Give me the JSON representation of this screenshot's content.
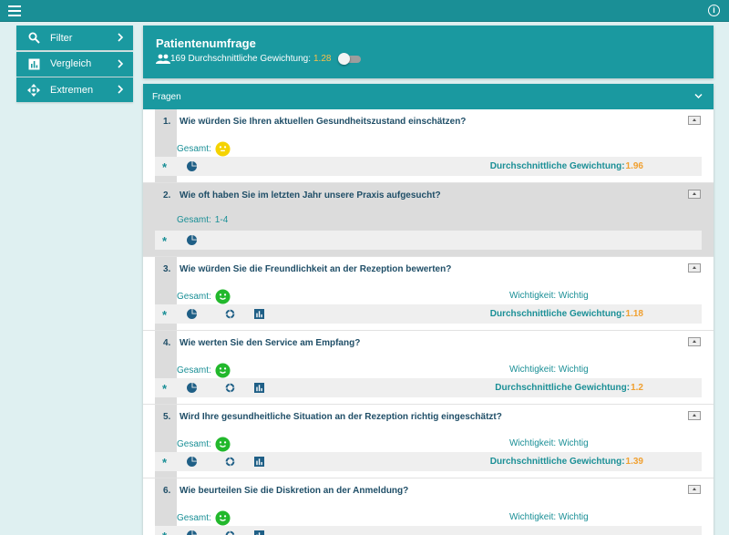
{
  "header": {
    "title": "Patientenumfrage",
    "count": "169",
    "avg_label": "Durchschnittliche Gewichtung:",
    "avg_value": "1.28"
  },
  "sidebar": {
    "items": [
      {
        "label": "Filter",
        "icon": "search-icon"
      },
      {
        "label": "Vergleich",
        "icon": "bar-chart-icon"
      },
      {
        "label": "Extremen",
        "icon": "move-arrows-icon"
      }
    ]
  },
  "fragen": {
    "title": "Fragen"
  },
  "questions": [
    {
      "num": "1.",
      "text": "Wie würden Sie Ihren aktuellen Gesundheitszustand einschätzen?",
      "gesamt_label": "Gesamt:",
      "gesamt_value": "",
      "smiley": "neutral-yellow",
      "wichtigkeit": "",
      "avg_label": "Durchschnittliche Gewichtung:",
      "avg_value": "1.96"
    },
    {
      "num": "2.",
      "text": "Wie oft haben Sie im letzten Jahr unsere Praxis aufgesucht?",
      "gesamt_label": "Gesamt:",
      "gesamt_value": "1-4",
      "smiley": "",
      "wichtigkeit": "",
      "avg_label": "",
      "avg_value": ""
    },
    {
      "num": "3.",
      "text": "Wie würden Sie die Freundlichkeit an der Rezeption bewerten?",
      "gesamt_label": "Gesamt:",
      "gesamt_value": "",
      "smiley": "happy-green",
      "wichtigkeit": "Wichtigkeit: Wichtig",
      "avg_label": "Durchschnittliche Gewichtung:",
      "avg_value": "1.18"
    },
    {
      "num": "4.",
      "text": "Wie werten Sie den Service am Empfang?",
      "gesamt_label": "Gesamt:",
      "gesamt_value": "",
      "smiley": "happy-green",
      "wichtigkeit": "Wichtigkeit: Wichtig",
      "avg_label": "Durchschnittliche Gewichtung:",
      "avg_value": "1.2"
    },
    {
      "num": "5.",
      "text": "Wird Ihre gesundheitliche Situation an der Rezeption richtig eingeschätzt?",
      "gesamt_label": "Gesamt:",
      "gesamt_value": "",
      "smiley": "happy-green",
      "wichtigkeit": "Wichtigkeit: Wichtig",
      "avg_label": "Durchschnittliche Gewichtung:",
      "avg_value": "1.39"
    },
    {
      "num": "6.",
      "text": "Wie beurteilen Sie die Diskretion an der Anmeldung?",
      "gesamt_label": "Gesamt:",
      "gesamt_value": "",
      "smiley": "happy-green",
      "wichtigkeit": "Wichtigkeit: Wichtig",
      "avg_label": "",
      "avg_value": ""
    }
  ],
  "footer_star": "*",
  "colors": {
    "teal": "#1a99a0",
    "accent": "#f0a030"
  }
}
